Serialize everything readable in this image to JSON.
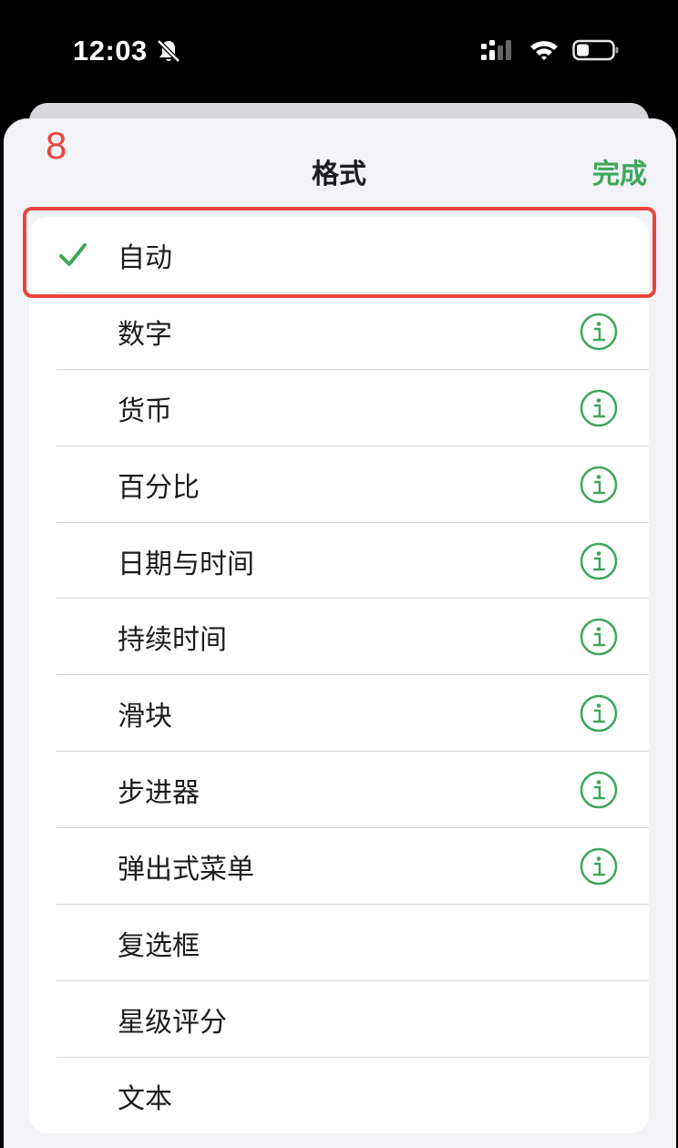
{
  "status_bar": {
    "time": "12:03",
    "silent_icon": "bell-slash-icon",
    "signal_icon": "cellular-signal-icon",
    "wifi_icon": "wifi-icon",
    "battery_icon": "battery-icon"
  },
  "annotation": {
    "step_number": "8"
  },
  "sheet": {
    "title": "格式",
    "done_label": "完成"
  },
  "format_list": {
    "selected_index": 0,
    "items": [
      {
        "label": "自动",
        "checked": true,
        "has_info": false
      },
      {
        "label": "数字",
        "checked": false,
        "has_info": true
      },
      {
        "label": "货币",
        "checked": false,
        "has_info": true
      },
      {
        "label": "百分比",
        "checked": false,
        "has_info": true
      },
      {
        "label": "日期与时间",
        "checked": false,
        "has_info": true
      },
      {
        "label": "持续时间",
        "checked": false,
        "has_info": true
      },
      {
        "label": "滑块",
        "checked": false,
        "has_info": true
      },
      {
        "label": "步进器",
        "checked": false,
        "has_info": true
      },
      {
        "label": "弹出式菜单",
        "checked": false,
        "has_info": true
      },
      {
        "label": "复选框",
        "checked": false,
        "has_info": false
      },
      {
        "label": "星级评分",
        "checked": false,
        "has_info": false
      },
      {
        "label": "文本",
        "checked": false,
        "has_info": false
      }
    ]
  },
  "colors": {
    "accent_green": "#3ea65b",
    "highlight_red": "#e8453c",
    "sheet_background": "#f2f2f7"
  }
}
